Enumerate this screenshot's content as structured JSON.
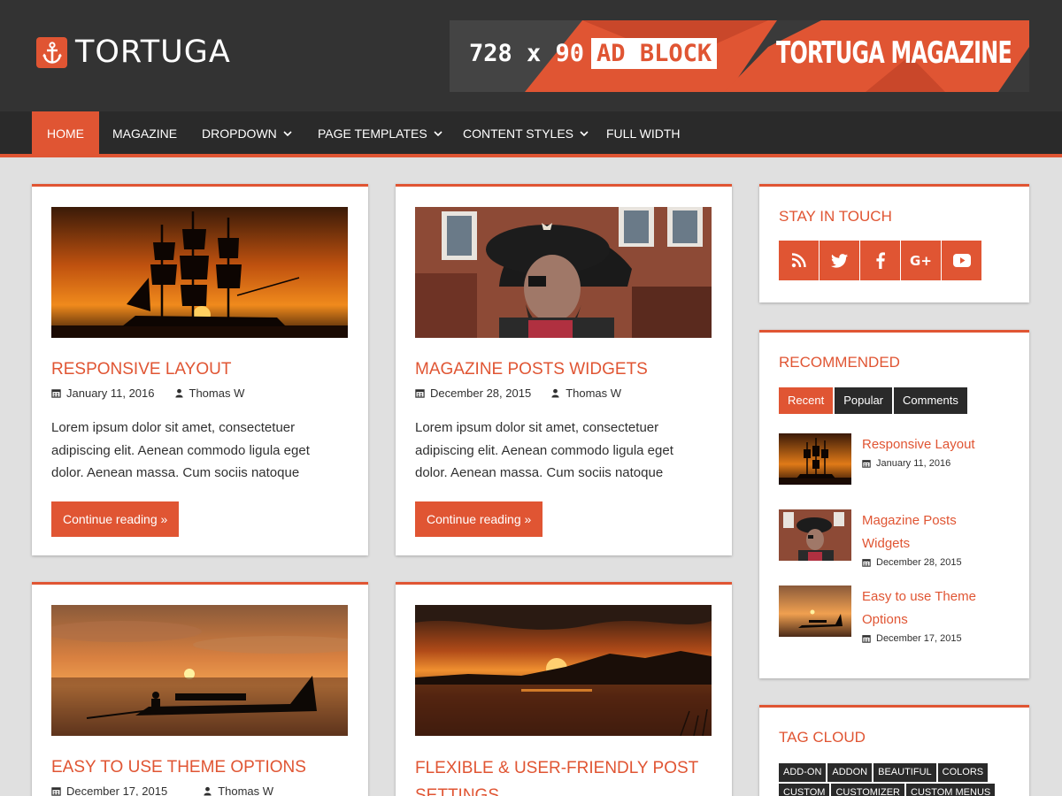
{
  "site": {
    "name": "TORTUGA"
  },
  "ad": {
    "size_text": "728 x 90",
    "highlight": "AD BLOCK",
    "brand": "TORTUGA MAGAZINE"
  },
  "nav": {
    "items": [
      {
        "label": "HOME",
        "active": true
      },
      {
        "label": "MAGAZINE"
      },
      {
        "label": "DROPDOWN",
        "has_dropdown": true
      },
      {
        "label": "PAGE TEMPLATES",
        "has_dropdown": true
      },
      {
        "label": "CONTENT STYLES",
        "has_dropdown": true
      },
      {
        "label": "FULL WIDTH"
      }
    ]
  },
  "posts": [
    {
      "title": "RESPONSIVE LAYOUT",
      "date": "January 11, 2016",
      "author": "Thomas W",
      "excerpt": "Lorem ipsum dolor sit amet, consectetuer adipiscing elit. Aenean commodo ligula eget dolor. Aenean massa. Cum sociis natoque",
      "button": "Continue reading »",
      "image": "tall-ship-sunset-image"
    },
    {
      "title": "MAGAZINE POSTS WIDGETS",
      "date": "December 28, 2015",
      "author": "Thomas W",
      "excerpt": "Lorem ipsum dolor sit amet, consectetuer adipiscing elit. Aenean commodo ligula eget dolor. Aenean massa. Cum sociis natoque",
      "button": "Continue reading »",
      "image": "pirate-statue-image"
    },
    {
      "title": "EASY TO USE THEME OPTIONS",
      "date": "December 17, 2015",
      "author": "Thomas W",
      "image": "boat-sunset-image"
    },
    {
      "title": "FLEXIBLE & USER-FRIENDLY POST SETTINGS",
      "image": "mountain-sunset-image"
    }
  ],
  "sidebar": {
    "stay_in_touch": {
      "title": "STAY IN TOUCH",
      "icons": [
        "rss-icon",
        "twitter-icon",
        "facebook-icon",
        "google-plus-icon",
        "youtube-icon"
      ]
    },
    "recommended": {
      "title": "RECOMMENDED",
      "tabs": [
        {
          "label": "Recent",
          "active": true
        },
        {
          "label": "Popular"
        },
        {
          "label": "Comments"
        }
      ],
      "items": [
        {
          "title": "Responsive Layout",
          "date": "January 11, 2016"
        },
        {
          "title": "Magazine Posts Widgets",
          "date": "December 28, 2015"
        },
        {
          "title": "Easy to use Theme Options",
          "date": "December 17, 2015"
        }
      ]
    },
    "tag_cloud": {
      "title": "TAG CLOUD",
      "tags": [
        "ADD-ON",
        "ADDON",
        "BEAUTIFUL",
        "COLORS",
        "CUSTOM",
        "CUSTOMIZER",
        "CUSTOM MENUS"
      ]
    }
  },
  "colors": {
    "accent": "#e05533",
    "header_bg": "#333333",
    "nav_bg": "#2a2a2a",
    "page_bg": "#e0e0e0"
  }
}
